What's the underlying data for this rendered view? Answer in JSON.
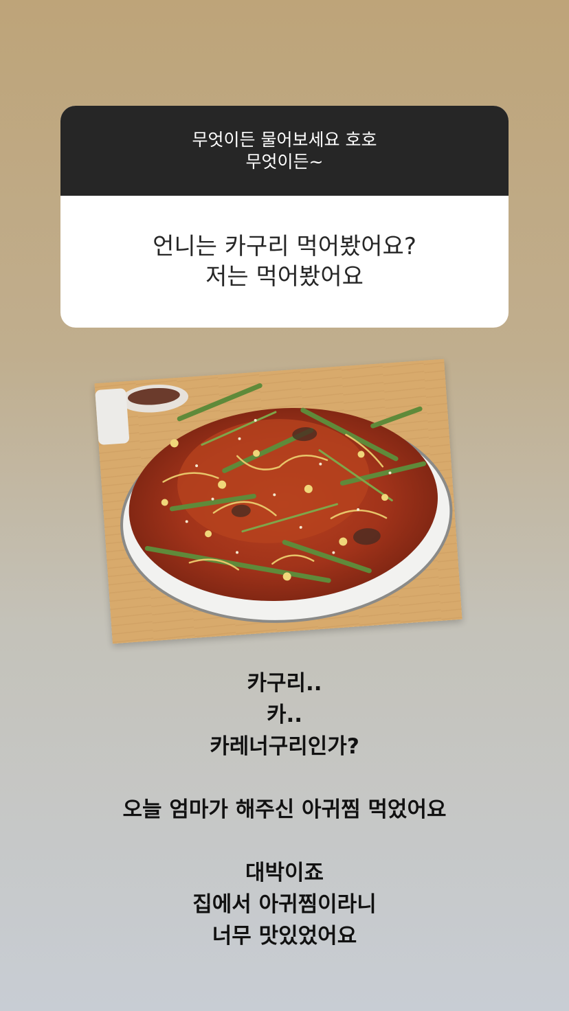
{
  "question_sticker": {
    "prompt_lines": [
      "무엇이든 물어보세요 호호",
      "무엇이든~"
    ],
    "answer_lines": [
      "언니는 카구리 먹어봤어요?",
      "저는 먹어봤어요"
    ]
  },
  "photo": {
    "subject": "spicy braised monkfish (agujjim) on a plate"
  },
  "story_caption": {
    "lines": [
      "카구리..",
      "카..",
      "카레너구리인가?",
      "",
      "오늘 엄마가 해주신 아귀찜 먹었어요",
      "",
      "대박이죠",
      "집에서 아귀찜이라니",
      "너무 맛있었어요"
    ]
  },
  "colors": {
    "card_header_bg": "#262626",
    "card_body_bg": "#ffffff",
    "text_dark": "#111111"
  }
}
